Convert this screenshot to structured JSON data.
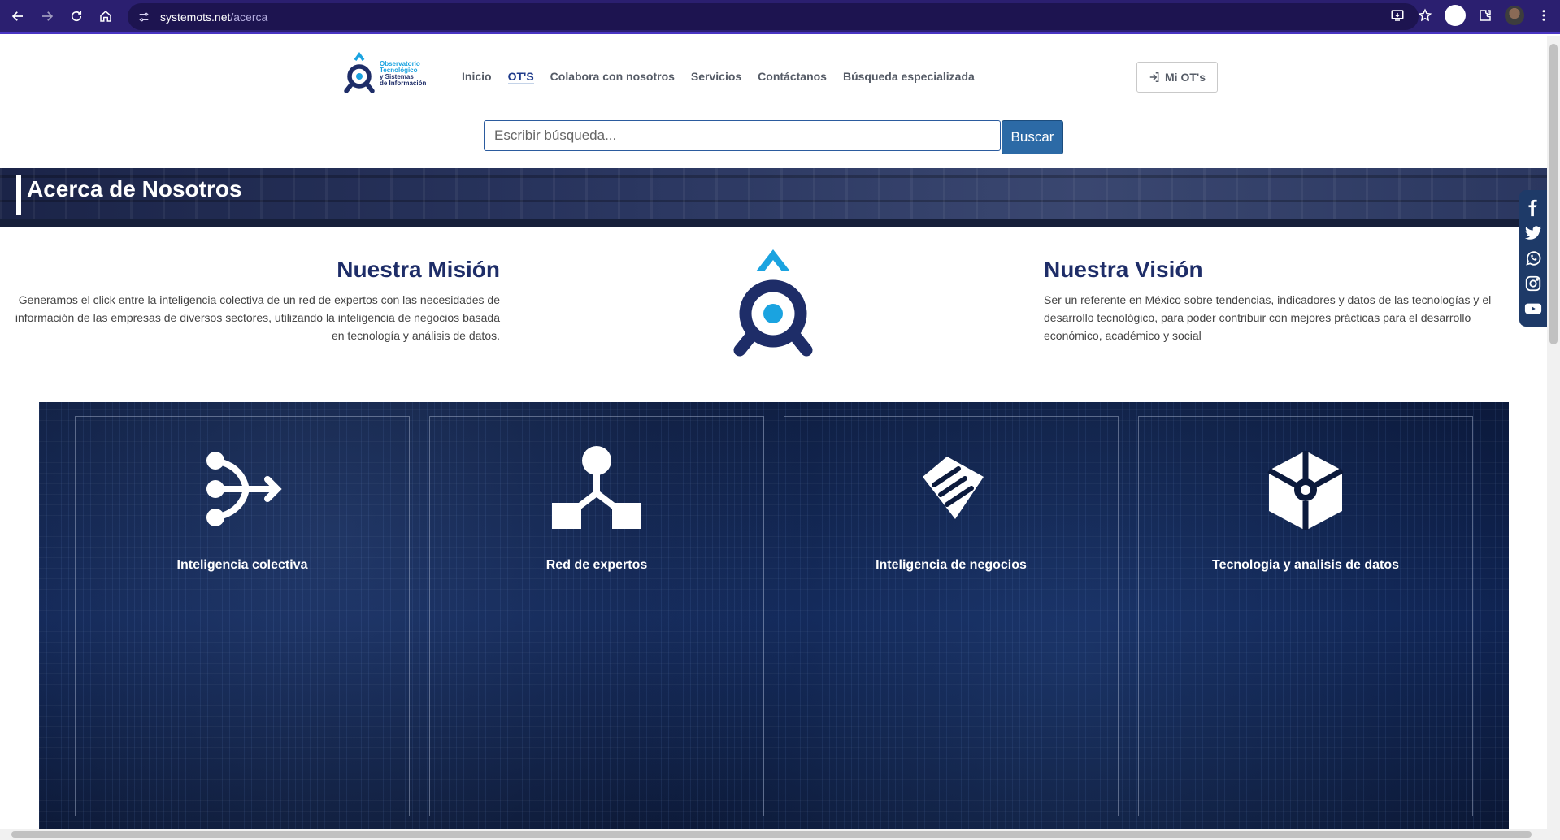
{
  "browser": {
    "url_host": "systemots.net",
    "url_path": "/acerca"
  },
  "header": {
    "logo_lines": [
      "Observatorio",
      "Tecnológico",
      "y Sistemas",
      "de Información"
    ],
    "nav": [
      {
        "label": "Inicio",
        "active": false
      },
      {
        "label": "OT'S",
        "active": true
      },
      {
        "label": "Colabora con nosotros",
        "active": false
      },
      {
        "label": "Servicios",
        "active": false
      },
      {
        "label": "Contáctanos",
        "active": false
      },
      {
        "label": "Búsqueda especializada",
        "active": false
      }
    ],
    "account_button": "Mi OT's",
    "search_placeholder": "Escribir búsqueda...",
    "search_button": "Buscar"
  },
  "banner": {
    "title": "Acerca de Nosotros"
  },
  "mission": {
    "title": "Nuestra Misión",
    "text": "Generamos el click entre la inteligencia colectiva de un red de expertos con las necesidades de información de las empresas de diversos sectores, utilizando la inteligencia de negocios basada en tecnología y análisis de datos."
  },
  "vision": {
    "title": "Nuestra Visión",
    "text": "Ser un referente en México sobre tendencias, indicadores y datos de las tecnologías y el desarrollo tecnológico, para poder contribuir con mejores prácticas para el desarrollo económico, académico y social"
  },
  "social": [
    "facebook-icon",
    "twitter-icon",
    "whatsapp-icon",
    "instagram-icon",
    "youtube-icon"
  ],
  "features": [
    {
      "label": "Inteligencia colectiva",
      "icon": "merge-arrows-icon"
    },
    {
      "label": "Red de expertos",
      "icon": "network-tree-icon"
    },
    {
      "label": "Inteligencia de negocios",
      "icon": "handshake-icon"
    },
    {
      "label": "Tecnologia y analisis de datos",
      "icon": "cube-icon"
    }
  ],
  "colors": {
    "brand_dark": "#1e2d68",
    "brand_light": "#1aa3e0",
    "search_button": "#2c6aa6",
    "browser_bar": "#2b1f70"
  }
}
